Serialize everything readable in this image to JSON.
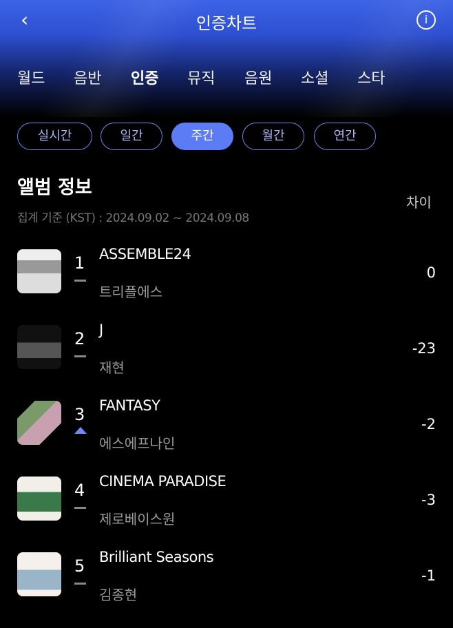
{
  "header": {
    "title": "인증차트",
    "back_icon": "chevron-left-icon",
    "info_icon": "info-circle-icon"
  },
  "tabs": [
    {
      "label": "월드"
    },
    {
      "label": "음반"
    },
    {
      "label": "인증",
      "active": true
    },
    {
      "label": "뮤직"
    },
    {
      "label": "음원"
    },
    {
      "label": "소셜"
    },
    {
      "label": "스타"
    }
  ],
  "periods": [
    {
      "label": "실시간"
    },
    {
      "label": "일간"
    },
    {
      "label": "주간",
      "active": true
    },
    {
      "label": "월간"
    },
    {
      "label": "연간"
    }
  ],
  "section": {
    "title": "앨범 정보",
    "period": "집계 기준 (KST) : 2024.09.02 ~ 2024.09.08",
    "diff_header": "차이"
  },
  "colors": {
    "accent": "#5b7cf5",
    "up": "#6f8cf5"
  },
  "rows": [
    {
      "rank": "1",
      "trend": "same",
      "title": "ASSEMBLE24",
      "artist": "트리플에스",
      "diff": "0"
    },
    {
      "rank": "2",
      "trend": "same",
      "title": "J",
      "artist": "재현",
      "diff": "-23"
    },
    {
      "rank": "3",
      "trend": "up",
      "title": "FANTASY",
      "artist": "에스에프나인",
      "diff": "-2"
    },
    {
      "rank": "4",
      "trend": "same",
      "title": "CINEMA PARADISE",
      "artist": "제로베이스원",
      "diff": "-3"
    },
    {
      "rank": "5",
      "trend": "same",
      "title": "Brilliant Seasons",
      "artist": "김종현",
      "diff": "-1"
    }
  ]
}
